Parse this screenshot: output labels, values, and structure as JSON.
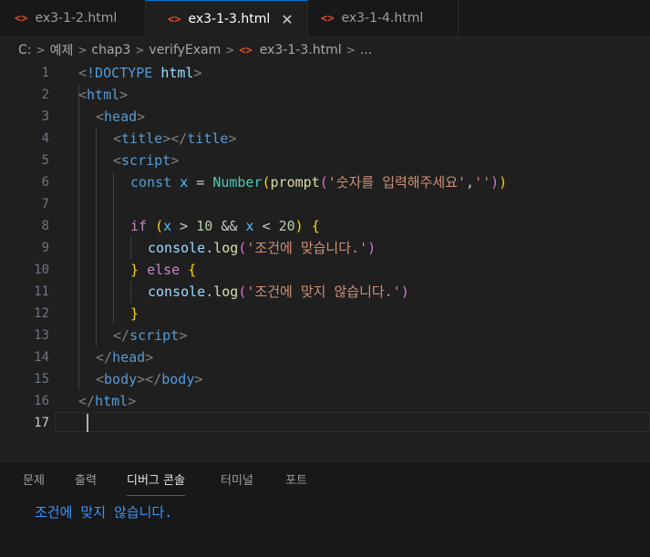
{
  "tabs": [
    {
      "icon": "<>",
      "label": "ex3-1-2.html",
      "active": false
    },
    {
      "icon": "<>",
      "label": "ex3-1-3.html",
      "active": true,
      "close": "✕"
    },
    {
      "icon": "<>",
      "label": "ex3-1-4.html",
      "active": false
    }
  ],
  "breadcrumb": [
    "C:",
    "예제",
    "chap3",
    "verifyExam",
    "ex3-1-3.html",
    "..."
  ],
  "breadcrumb_sep": ">",
  "line_numbers": [
    "1",
    "2",
    "3",
    "4",
    "5",
    "6",
    "7",
    "8",
    "9",
    "10",
    "11",
    "12",
    "13",
    "14",
    "15",
    "16",
    "17"
  ],
  "current_line": "17",
  "code": {
    "l1": [
      "<",
      "!DOCTYPE",
      " ",
      "html",
      ">"
    ],
    "l2": [
      "<",
      "html",
      ">"
    ],
    "l3": [
      "<",
      "head",
      ">"
    ],
    "l4": [
      "<",
      "title",
      "></",
      "title",
      ">"
    ],
    "l5": [
      "<",
      "script",
      ">"
    ],
    "l6": [
      "const",
      " ",
      "x",
      " = ",
      "Number",
      "(",
      "prompt",
      "(",
      "'숫자를 입력해주세요'",
      ",",
      "''",
      ")",
      ")"
    ],
    "l8": [
      "if",
      " ",
      "(",
      "x",
      " > ",
      "10",
      " && ",
      "x",
      " < ",
      "20",
      ")",
      " ",
      "{"
    ],
    "l9": [
      "console",
      ".",
      "log",
      "(",
      "'조건에 맞습니다.'",
      ")"
    ],
    "l10": [
      "}",
      " ",
      "else",
      " ",
      "{"
    ],
    "l11": [
      "console",
      ".",
      "log",
      "(",
      "'조건에 맞지 않습니다.'",
      ")"
    ],
    "l12": [
      "}"
    ],
    "l13": [
      "</",
      "script",
      ">"
    ],
    "l14": [
      "</",
      "head",
      ">"
    ],
    "l15": [
      "<",
      "body",
      "></",
      "body",
      ">"
    ],
    "l16": [
      "</",
      "html",
      ">"
    ]
  },
  "panel": {
    "tabs": [
      "문제",
      "출력",
      "디버그 콘솔",
      "터미널",
      "포트"
    ],
    "active_tab": "디버그 콘솔",
    "output": "조건에 맞지 않습니다."
  },
  "colors": {
    "background": "#1f1f1f",
    "tag": "#569cd6",
    "string": "#ce9178",
    "function": "#dcdcaa",
    "variable": "#4fc1ff",
    "class": "#4ec9b0",
    "control": "#c586c0",
    "accent": "#0078d4",
    "output": "#3794ff"
  }
}
